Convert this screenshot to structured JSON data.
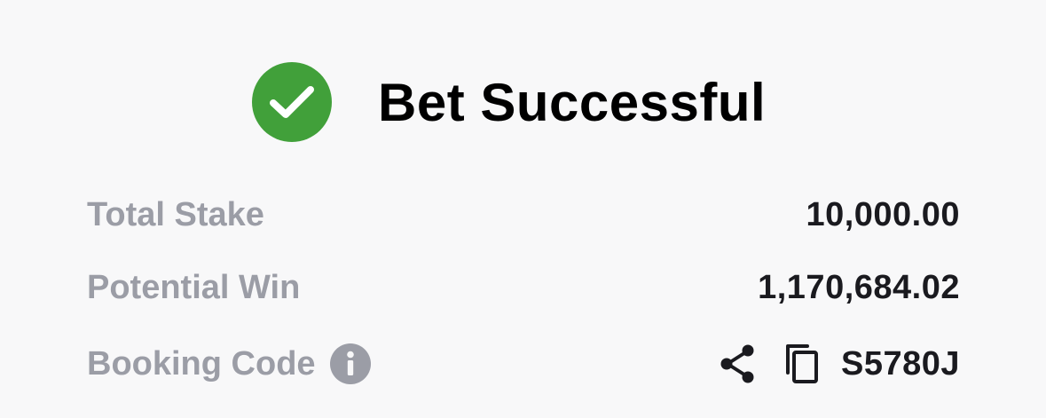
{
  "header": {
    "status_icon": "check-circle-icon",
    "title": "Bet Successful",
    "accent_color": "#41a03a"
  },
  "summary": {
    "total_stake": {
      "label": "Total Stake",
      "value": "10,000.00"
    },
    "potential_win": {
      "label": "Potential Win",
      "value": "1,170,684.02"
    },
    "booking_code": {
      "label": "Booking Code",
      "info_icon": "info-icon",
      "share_icon": "share-icon",
      "copy_icon": "copy-icon",
      "value": "S5780J"
    }
  },
  "colors": {
    "label": "#9b9da6",
    "value": "#1a1a1f",
    "background": "#f8f8f9"
  }
}
